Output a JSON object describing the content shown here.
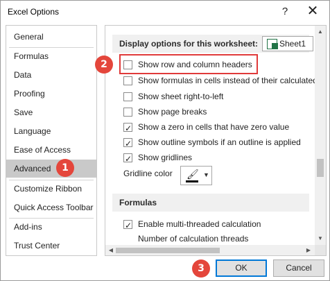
{
  "window": {
    "title": "Excel Options",
    "help_glyph": "?",
    "close_glyph": "✕"
  },
  "sidebar": {
    "items": [
      {
        "label": "General"
      },
      {
        "label": "Formulas"
      },
      {
        "label": "Data"
      },
      {
        "label": "Proofing"
      },
      {
        "label": "Save"
      },
      {
        "label": "Language"
      },
      {
        "label": "Ease of Access"
      },
      {
        "label": "Advanced",
        "selected": true
      },
      {
        "label": "Customize Ribbon"
      },
      {
        "label": "Quick Access Toolbar"
      },
      {
        "label": "Add-ins"
      },
      {
        "label": "Trust Center"
      }
    ]
  },
  "display_section": {
    "header": "Display options for this worksheet:",
    "sheet_selected": "Sheet1",
    "options": [
      {
        "label": "Show row and column headers",
        "checked": false
      },
      {
        "label": "Show formulas in cells instead of their calculated",
        "checked": false
      },
      {
        "label": "Show sheet right-to-left",
        "checked": false
      },
      {
        "label": "Show page breaks",
        "checked": false
      },
      {
        "label": "Show a zero in cells that have zero value",
        "checked": true
      },
      {
        "label": "Show outline symbols if an outline is applied",
        "checked": true
      },
      {
        "label": "Show gridlines",
        "checked": true
      }
    ],
    "gridline_color_label": "Gridline color"
  },
  "formulas_section": {
    "header": "Formulas",
    "options": [
      {
        "label": "Enable multi-threaded calculation",
        "checked": true
      }
    ],
    "threads_label": "Number of calculation threads"
  },
  "buttons": {
    "ok": "OK",
    "cancel": "Cancel"
  },
  "markers": {
    "m1": "1",
    "m2": "2",
    "m3": "3"
  },
  "colors": {
    "marker": "#e4463b",
    "highlight": "#e03a3a",
    "selected_nav": "#c9c9c9",
    "ok_border": "#0078d7"
  }
}
